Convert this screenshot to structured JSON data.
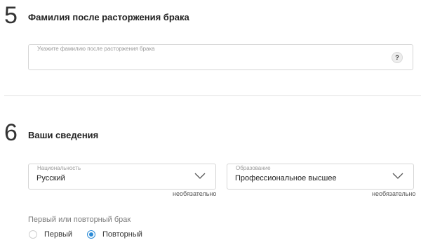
{
  "section5": {
    "number": "5",
    "title": "Фамилия после расторжения брака",
    "surname_field": {
      "placeholder": "Укажите фамилию после расторжения брака",
      "value": "",
      "help_label": "?"
    }
  },
  "section6": {
    "number": "6",
    "title": "Ваши сведения",
    "nationality_field": {
      "label": "Национальность",
      "value": "Русский",
      "optional_note": "необязательно"
    },
    "education_field": {
      "label": "Образование",
      "value": "Профессиональное высшее",
      "optional_note": "необязательно"
    },
    "marriage_group": {
      "label": "Первый или повторный брак",
      "options": [
        {
          "label": "Первый",
          "selected": false
        },
        {
          "label": "Повторный",
          "selected": true
        }
      ]
    }
  },
  "colors": {
    "accent": "#2a8ad6",
    "border": "#d6d6d6",
    "divider": "#e2e2e2"
  }
}
